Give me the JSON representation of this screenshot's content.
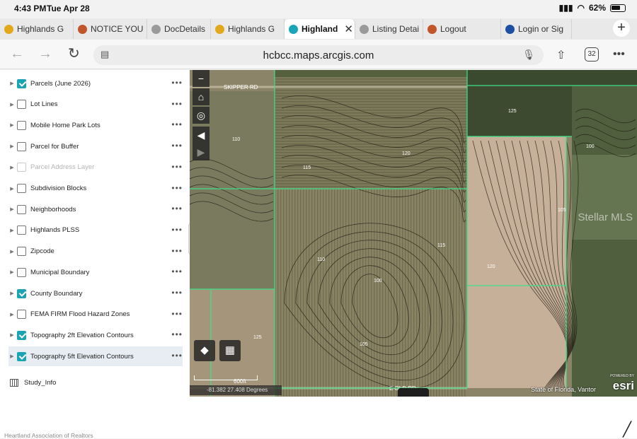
{
  "status_bar": {
    "time": "4:43 PM",
    "date": "Tue Apr 28",
    "battery": "62%"
  },
  "tabs": [
    {
      "label": "Highlands G",
      "icon_color": "#e2a81b",
      "active": false
    },
    {
      "label": "NOTICE YOU",
      "icon_color": "#c0562a",
      "active": false
    },
    {
      "label": "DocDetails",
      "icon_color": "#9a9a9a",
      "active": false
    },
    {
      "label": "Highlands G",
      "icon_color": "#e2a81b",
      "active": false
    },
    {
      "label": "Highland",
      "icon_color": "#19a7b8",
      "active": true
    },
    {
      "label": "Listing Detai",
      "icon_color": "#9a9a9a",
      "active": false
    },
    {
      "label": "Logout",
      "icon_color": "#c0562a",
      "active": false
    },
    {
      "label": "Login or Sig",
      "icon_color": "#1f4fa3",
      "active": false
    }
  ],
  "toolbar": {
    "url": "hcbcc.maps.arcgis.com",
    "tab_count": "32"
  },
  "layers": [
    {
      "label": "Parcels (June 2026)",
      "checked": true,
      "dim": false,
      "selected": false
    },
    {
      "label": "Lot Lines",
      "checked": false,
      "dim": false,
      "selected": false
    },
    {
      "label": "Mobile Home Park Lots",
      "checked": false,
      "dim": false,
      "selected": false
    },
    {
      "label": "Parcel for Buffer",
      "checked": false,
      "dim": false,
      "selected": false
    },
    {
      "label": "Parcel Address Layer",
      "checked": false,
      "dim": true,
      "selected": false
    },
    {
      "label": "Subdivision Blocks",
      "checked": false,
      "dim": false,
      "selected": false
    },
    {
      "label": "Neighborhoods",
      "checked": false,
      "dim": false,
      "selected": false
    },
    {
      "label": "Highlands PLSS",
      "checked": false,
      "dim": false,
      "selected": false
    },
    {
      "label": "Zipcode",
      "checked": false,
      "dim": false,
      "selected": false
    },
    {
      "label": "Municipal Boundary",
      "checked": false,
      "dim": false,
      "selected": false
    },
    {
      "label": "County Boundary",
      "checked": true,
      "dim": false,
      "selected": false
    },
    {
      "label": "FEMA FIRM Flood Hazard Zones",
      "checked": false,
      "dim": false,
      "selected": false
    },
    {
      "label": "Topography 2ft Elevation Contours",
      "checked": true,
      "dim": false,
      "selected": false
    },
    {
      "label": "Topography 5ft Elevation Contours",
      "checked": true,
      "dim": false,
      "selected": true
    }
  ],
  "table_item": {
    "label": "Study_Info"
  },
  "map": {
    "road_north": "SKIPPER RD",
    "road_south": "E OLD RD",
    "scale_label": "600ft",
    "coordinates": "-81.382 27.408 Degrees",
    "attribution": "State of Florida, Vantor",
    "esri_label": "esri",
    "powered_by": "POWERED BY",
    "watermark": "Stellar MLS",
    "contour_labels": [
      "110",
      "115",
      "120",
      "125",
      "105",
      "100"
    ],
    "parcel_line_color": "#3fe08a"
  },
  "footer": {
    "mls_credit": "Heartland Association of Realtors"
  }
}
